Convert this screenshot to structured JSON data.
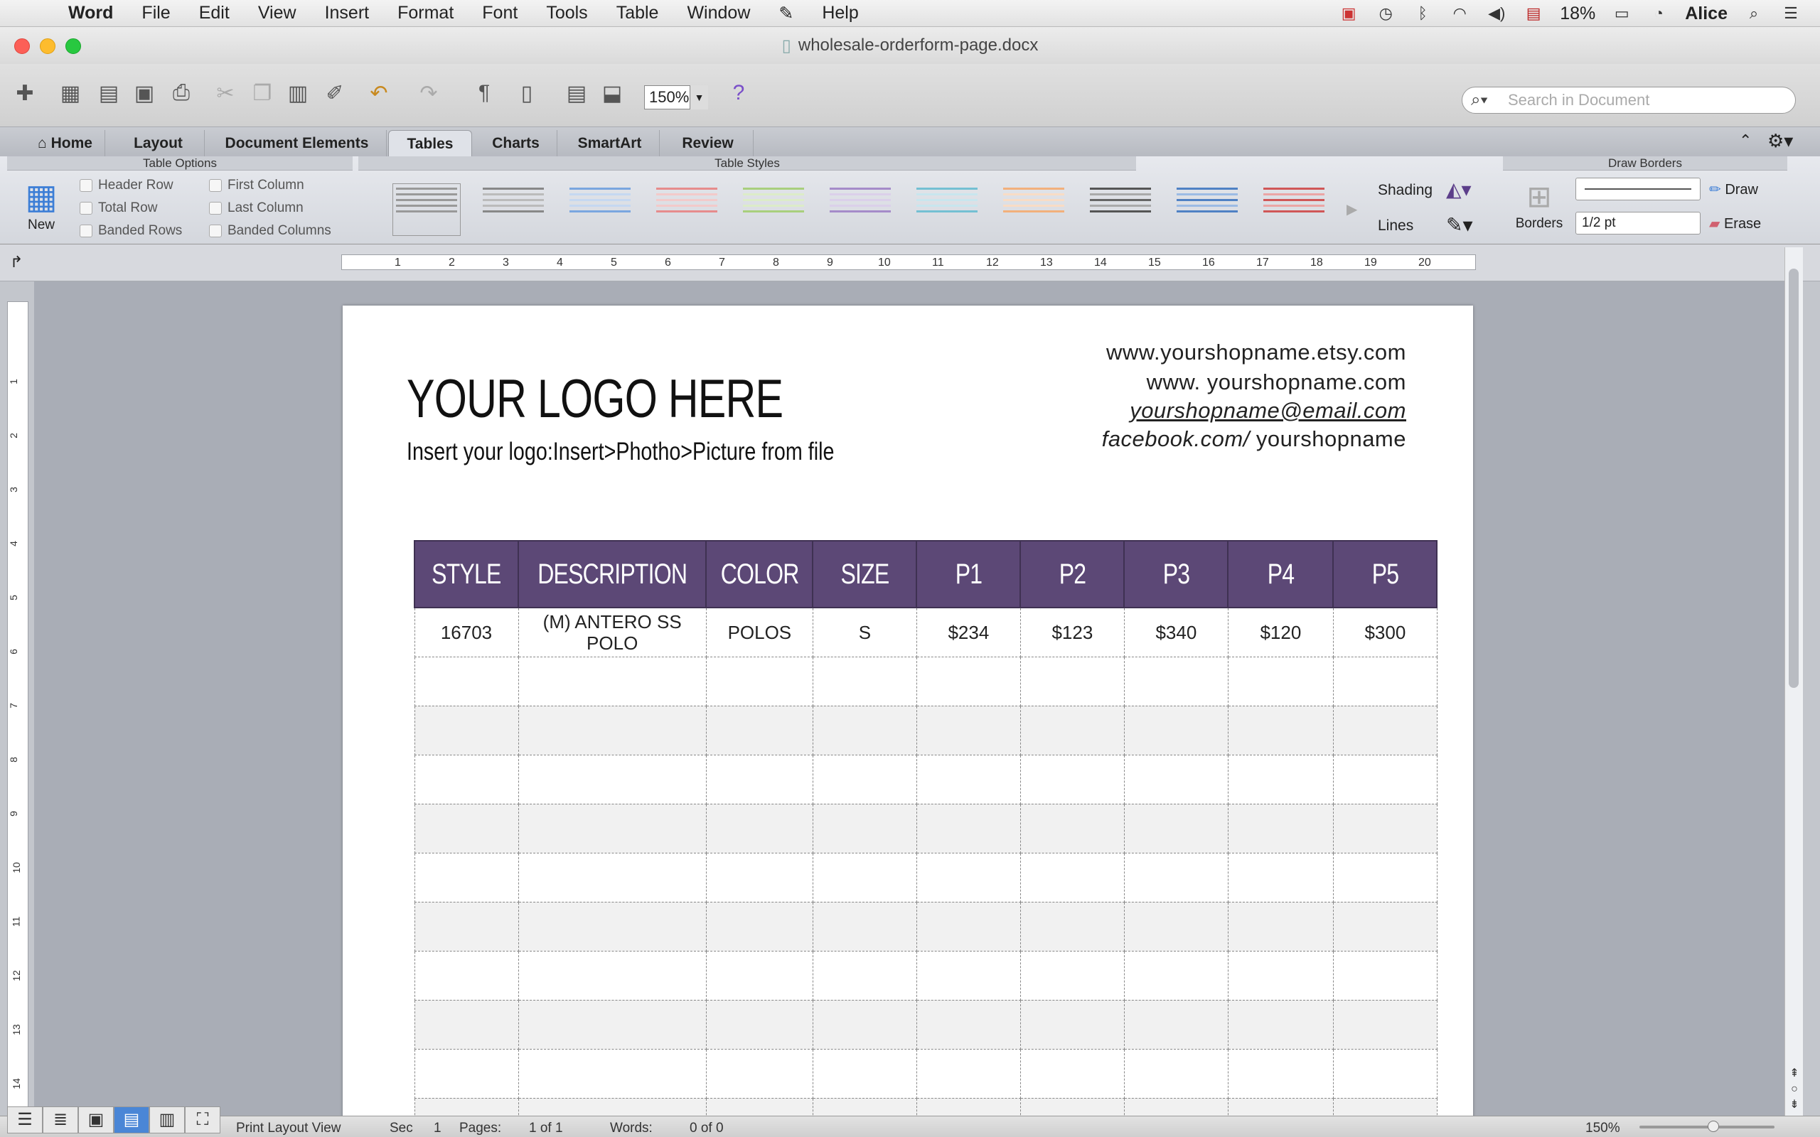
{
  "menubar": {
    "app": "Word",
    "items": [
      "File",
      "Edit",
      "View",
      "Insert",
      "Format",
      "Font",
      "Tools",
      "Table",
      "Window",
      "Help"
    ],
    "battery": "18%",
    "user": "Alice"
  },
  "window": {
    "title": "wholesale-orderform-page.docx"
  },
  "toolbar": {
    "zoom": "150%",
    "search_placeholder": "Search in Document"
  },
  "ribbon_tabs": [
    "Home",
    "Layout",
    "Document Elements",
    "Tables",
    "Charts",
    "SmartArt",
    "Review"
  ],
  "table_options": {
    "title": "Table Options",
    "new_label": "New",
    "checks": [
      "Header Row",
      "Total Row",
      "Banded Rows",
      "First Column",
      "Last Column",
      "Banded Columns"
    ]
  },
  "table_styles": {
    "title": "Table Styles",
    "shading": "Shading",
    "lines": "Lines"
  },
  "draw_borders": {
    "title": "Draw Borders",
    "borders": "Borders",
    "weight": "1/2 pt",
    "draw": "Draw",
    "erase": "Erase"
  },
  "ruler": [
    "1",
    "2",
    "3",
    "4",
    "5",
    "6",
    "7",
    "8",
    "9",
    "10",
    "11",
    "12",
    "13",
    "14",
    "15",
    "16",
    "17",
    "18",
    "19",
    "20"
  ],
  "vruler": [
    "1",
    "2",
    "3",
    "4",
    "5",
    "6",
    "7",
    "8",
    "9",
    "10",
    "11",
    "12",
    "13",
    "14"
  ],
  "document": {
    "logo": "YOUR LOGO HERE",
    "logo_sub": "Insert your logo:Insert>Photho>Picture from file",
    "contact": [
      "www.yourshopname.etsy.com",
      "www. yourshopname.com",
      "yourshopname@email.com",
      "facebook.com/ yourshopname"
    ],
    "table": {
      "headers": [
        "STYLE",
        "DESCRIPTION",
        "COLOR",
        "SIZE",
        "P1",
        "P2",
        "P3",
        "P4",
        "P5"
      ],
      "row1": [
        "16703",
        "(M) ANTERO SS POLO",
        "POLOS",
        "S",
        "$234",
        "$123",
        "$340",
        "$120",
        "$300"
      ]
    }
  },
  "statusbar": {
    "view": "Print Layout View",
    "sec_label": "Sec",
    "sec": "1",
    "pages_label": "Pages:",
    "pages": "1 of 1",
    "words_label": "Words:",
    "words": "0 of 0",
    "zoom": "150%"
  },
  "colors": {
    "header_purple": "#5c4876",
    "accent_blue": "#4a86d6"
  }
}
